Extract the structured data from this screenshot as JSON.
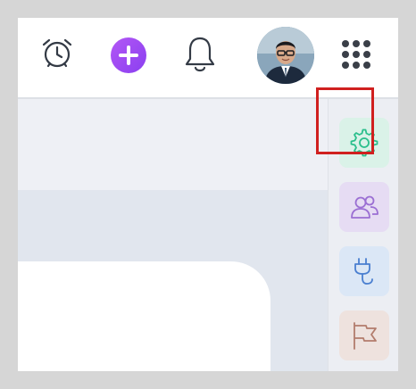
{
  "topbar": {
    "icons": {
      "alarm": "alarm-clock-icon",
      "add": "plus-icon",
      "notifications": "bell-icon",
      "apps": "grid-dots-icon"
    },
    "avatar": "user-avatar"
  },
  "rightbar": {
    "items": [
      {
        "icon": "gear-icon",
        "color": "#2bbf8c",
        "selected": true
      },
      {
        "icon": "users-icon",
        "color": "#9b6fd3",
        "selected": false
      },
      {
        "icon": "plug-icon",
        "color": "#4a7fd0",
        "selected": false
      },
      {
        "icon": "flag-icon",
        "color": "#b27c6c",
        "selected": false
      }
    ]
  },
  "colors": {
    "accent_purple": "#9b4df2",
    "highlight_red": "#d0201f"
  }
}
